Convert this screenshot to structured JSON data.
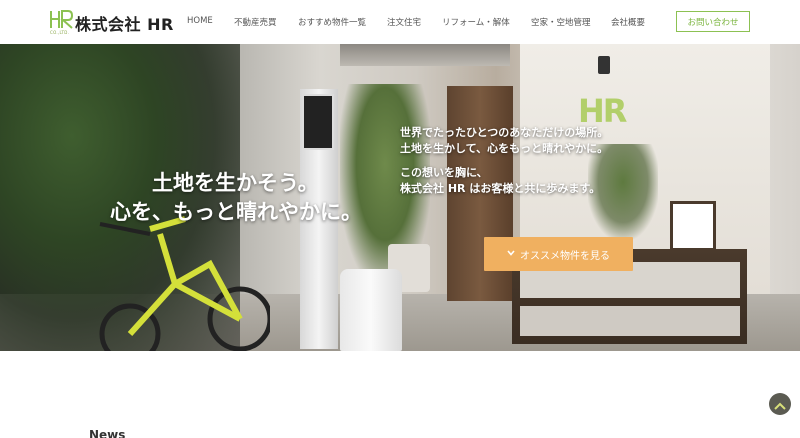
{
  "header": {
    "logo_mark": "HR",
    "logo_sub": "CO.,LTD.",
    "company_name": "株式会社 HR",
    "brand_color": "#8cc152"
  },
  "nav": {
    "items": [
      {
        "label": "HOME"
      },
      {
        "label": "不動産売買"
      },
      {
        "label": "おすすめ物件一覧"
      },
      {
        "label": "注文住宅"
      },
      {
        "label": "リフォーム・解体"
      },
      {
        "label": "空家・空地管理"
      },
      {
        "label": "会社概要"
      }
    ],
    "contact_label": "お問い合わせ"
  },
  "hero": {
    "title_line1": "土地を生かそう。",
    "title_line2": "心を、もっと晴れやかに。",
    "desc_line1": "世界でたったひとつのあなただけの場所。",
    "desc_line2": "土地を生かして、心をもっと晴れやかに。",
    "desc_line3": "この想いを胸に、",
    "desc_line4": "株式会社 HR はお客様と共に歩みます。",
    "cta_label": "オススメ物件を見る",
    "cta_color": "#f0b060",
    "sign_text": "HR"
  },
  "sections": {
    "news_title": "News"
  },
  "icons": {
    "cta_icon": "chevron-down-icon",
    "to_top_icon": "chevron-up-icon"
  }
}
